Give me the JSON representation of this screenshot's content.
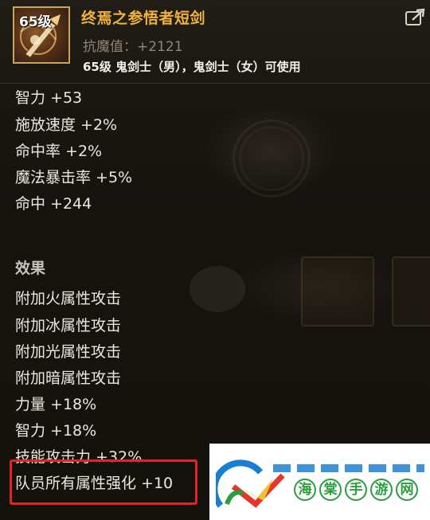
{
  "header": {
    "level_badge": "65级",
    "item_name": "终焉之参悟者短剑",
    "resist": "抗魔值：+2121",
    "usable": "65级 鬼剑士（男），鬼剑士（女）可使用",
    "share_icon": "share-arrow-icon"
  },
  "stats": [
    "智力 +53",
    "施放速度 +2%",
    "命中率 +2%",
    "魔法暴击率 +5%",
    "命中 +244"
  ],
  "effects": {
    "title": "效果",
    "items": [
      "附加火属性攻击",
      "附加冰属性攻击",
      "附加光属性攻击",
      "附加暗属性攻击",
      "力量 +18%",
      "智力 +18%",
      "技能攻击力 +32%",
      "队员所有属性强化 +10"
    ]
  },
  "watermark": {
    "chars": [
      "海",
      "棠",
      "手",
      "游",
      "网"
    ]
  },
  "colors": {
    "item_name": "#f0b23a",
    "highlight": "#e2261f",
    "watermark_green": "#2a9d3e"
  }
}
